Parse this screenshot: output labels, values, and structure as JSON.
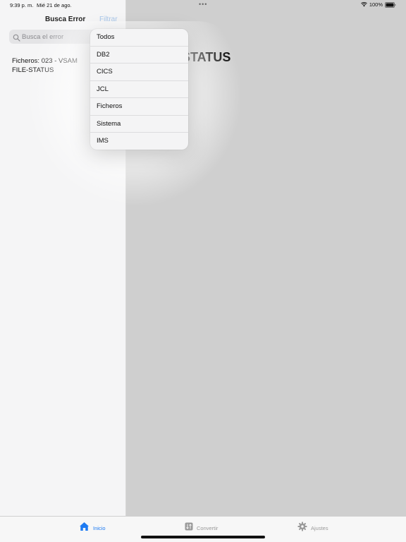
{
  "status_bar": {
    "time": "9:39 p. m.",
    "date": "Mié 21 de ago.",
    "dots": "•••",
    "battery_percent": "100%",
    "battery_level": 1.0
  },
  "sidebar": {
    "title": "Busca Error",
    "filter_label": "Filtrar",
    "search": {
      "placeholder": "Busca el error",
      "value": ""
    },
    "results": [
      {
        "text": "Ficheros:  023 - VSAM FILE-STATUS"
      }
    ]
  },
  "detail": {
    "title": "023 - VSAM FILE-STATUS",
    "visible_title": "STATUS"
  },
  "filter_menu": {
    "options": [
      "Todos",
      "DB2",
      "CICS",
      "JCL",
      "Ficheros",
      "Sistema",
      "IMS"
    ]
  },
  "tab_bar": {
    "tabs": [
      {
        "label": "Inicio",
        "icon": "house-icon",
        "active": true
      },
      {
        "label": "Convertir",
        "icon": "convert-icon",
        "active": false
      },
      {
        "label": "Ajustes",
        "icon": "gear-icon",
        "active": false
      }
    ]
  },
  "colors": {
    "accent": "#1e7bf2",
    "filter_disabled": "#a9c7ea",
    "detail_background": "#cfcfcf",
    "sidebar_background": "#f5f5f6"
  }
}
